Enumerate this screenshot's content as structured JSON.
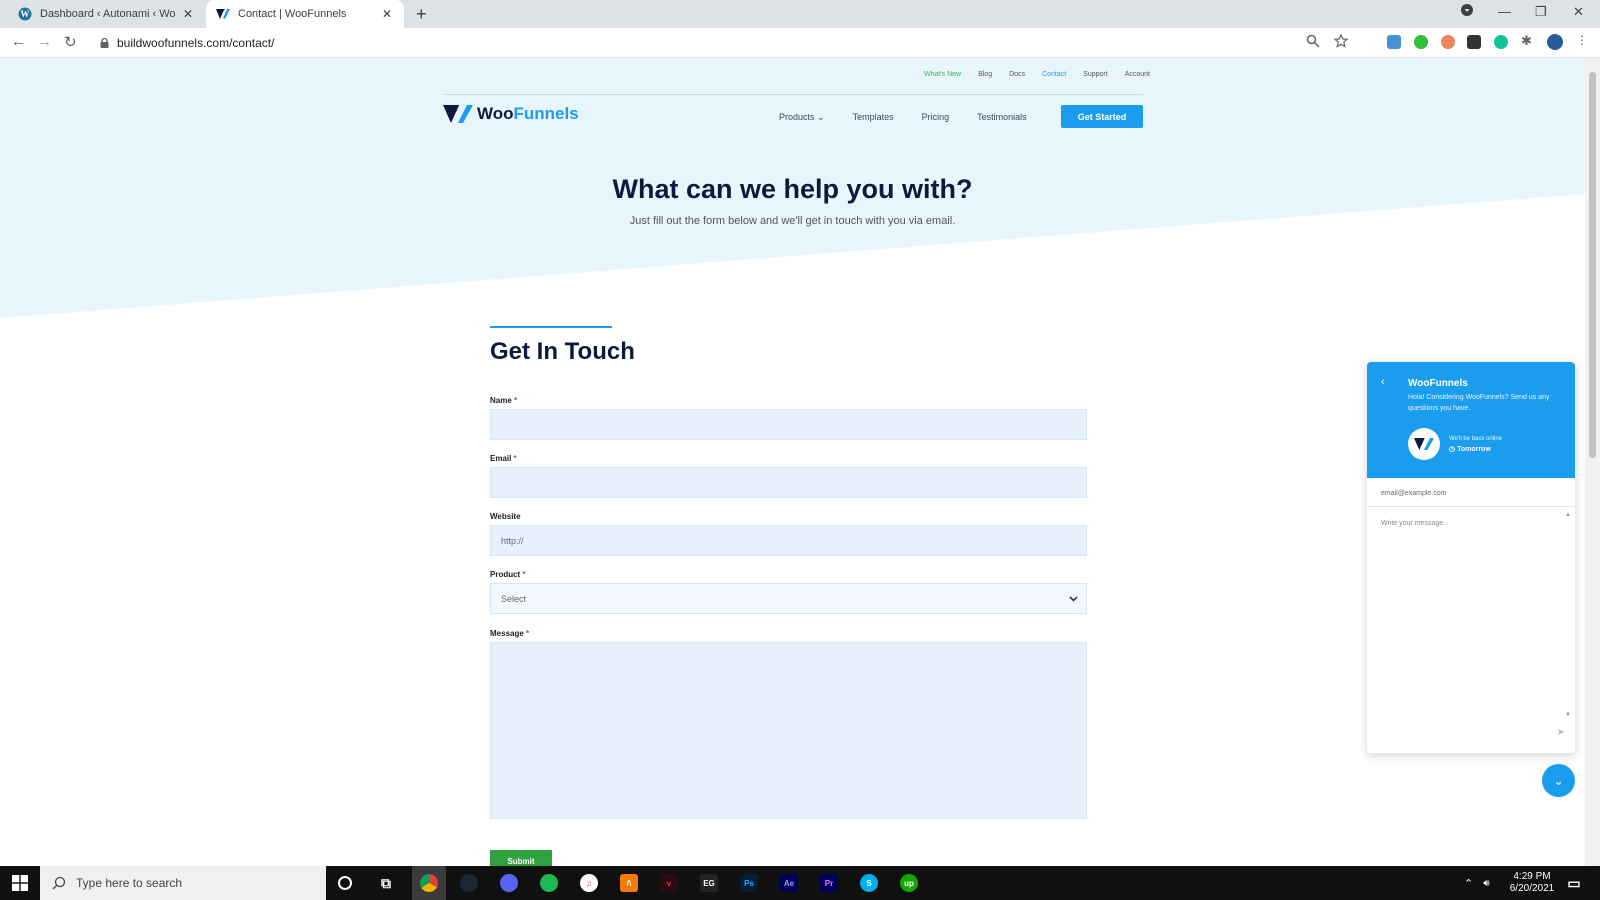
{
  "browser": {
    "tabs": [
      {
        "title": "Dashboard ‹ Autonami ‹ WooFunnels",
        "active": false
      },
      {
        "title": "Contact | WooFunnels",
        "active": true
      }
    ],
    "url": "buildwoofunnels.com/contact/",
    "new_tab": "+",
    "minimize": "—",
    "restore": "❐",
    "close": "✕"
  },
  "site": {
    "top_links": [
      "What's New",
      "Blog",
      "Docs",
      "Contact",
      "Support",
      "Account"
    ],
    "logo_word1": "Woo",
    "logo_word2": "Funnels",
    "nav": [
      "Products",
      "Templates",
      "Pricing",
      "Testimonials"
    ],
    "cta": "Get Started"
  },
  "hero": {
    "title": "What can we help you with?",
    "subtitle": "Just fill out the form below and we'll get in touch with you via email."
  },
  "form": {
    "title": "Get In Touch",
    "fields": {
      "name": "Name",
      "email": "Email",
      "website": "Website",
      "website_placeholder": "http://",
      "product": "Product",
      "product_value": "Select",
      "message": "Message"
    },
    "required_mark": "*",
    "submit": "Submit"
  },
  "chat": {
    "name": "WooFunnels",
    "description": "Hola! Considering WooFunnels? Send us any questions you have.",
    "status": "We'll be back online",
    "when": "Tomorrow",
    "email_placeholder": "email@example.com",
    "message_placeholder": "Write your message..."
  },
  "taskbar": {
    "search_placeholder": "Type here to search",
    "time": "4:29 PM",
    "date": "6/20/2021"
  },
  "colors": {
    "accent": "#1a9ded",
    "navy": "#0b1a3d",
    "green": "#2fa33f"
  }
}
